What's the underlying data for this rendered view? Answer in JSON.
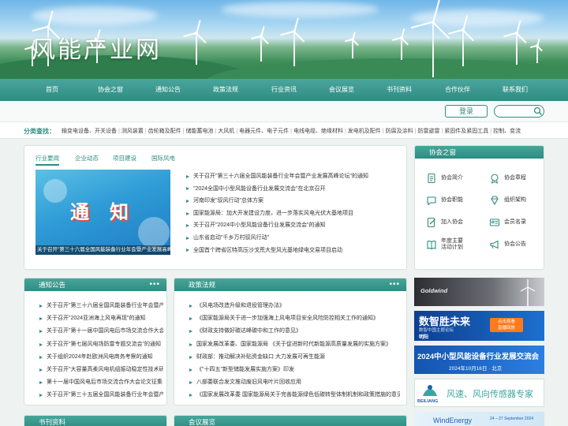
{
  "site": {
    "title": "风能产业网"
  },
  "nav": [
    "首页",
    "协会之窗",
    "通知公告",
    "政策法规",
    "行业资讯",
    "会议展览",
    "书刊资料",
    "合作伙伴",
    "联系我们"
  ],
  "subbar": {
    "login_label": "登录",
    "search_placeholder": ""
  },
  "categories": {
    "label": "分类查找：",
    "items": [
      "输变电设备、开关设备",
      "测风装置",
      "齿轮箱及配件",
      "储能蓄电池",
      "大风机",
      "电器元件、电子元件",
      "电线电缆、绝缘材料",
      "发电机及配件",
      "防腐及涂料",
      "防雷避雷",
      "紧固件及紧固工具",
      "控制、变流"
    ]
  },
  "news": {
    "tabs": [
      "行业要闻",
      "企业动态",
      "项目建设",
      "国际风电"
    ],
    "image_word": "通知",
    "image_caption": "关于召开\"第三十六届全国风能装备行业年会暨产业发展高峰论坛\"的通知",
    "items": [
      "关于召开\"第三十六届全国风能装备行业年会暨产业发展高峰论坛\"的通知",
      "\"2024全国中小型风能设备行业发展交流会\"在北京召开",
      "河南印发\"驭风行动\"总体方案",
      "国家能源局：加大开发建设力度，进一步落实风电光伏大基地项目",
      "关于召开\"2024中小型风能设备行业发展交流会\"的通知",
      "山东省启动\"千乡万村驭风行动\"",
      "全国首个跨省区特高压沙戈荒大型风光基地绿电交易项目启动"
    ]
  },
  "association": {
    "title": "协会之窗",
    "items": [
      {
        "label": "协会简介",
        "icon": "document-icon"
      },
      {
        "label": "协会章程",
        "icon": "seal-icon"
      },
      {
        "label": "协会职能",
        "icon": "chat-icon"
      },
      {
        "label": "组织架构",
        "icon": "diamond-icon"
      },
      {
        "label": "加入协会",
        "icon": "file-pen-icon"
      },
      {
        "label": "会员名录",
        "icon": "id-card-icon"
      },
      {
        "label": "年度主要\n活动计划",
        "icon": "book-icon"
      },
      {
        "label": "协会公告",
        "icon": "megaphone-icon"
      }
    ]
  },
  "notices": {
    "title": "通知公告",
    "more": "•••",
    "items": [
      "关于召开\"第三十六届全国风能装备行业年会暨产业发展高峰论坛\"的通知",
      "关于召开\"2024亚洲海上风电再现\"的通知",
      "关于召开\"第十一届中国风电后市场交流合作大会\"的通知",
      "关于召开\"第七届风电场防雷专题交流会\"的通知",
      "关于组织2024年赴欧洲风电商务考察的通知",
      "关于召开\"大容量高柔风电机组振动稳定性技术研讨会\"的通知",
      "第十一届中国风电后市场交流合作大会论文征集",
      "关于召开\"第三十五届全国风能装备行业年会暨产业发展高峰论坛\"的通知"
    ]
  },
  "policy": {
    "title": "政策法规",
    "more": "•••",
    "items": [
      "《风电场改造升级和退役管理办法》",
      "《国家能源局关于进一步加强海上风电项目安全风险防控相关工作的通知》",
      "《财政支持做好碳达峰碳中和工作的意见》",
      "国家发展改革委、国家能源局 《关于促进新时代新能源高质量发展的实施方案》",
      "财政部：推动解决补贴资金缺口 大力发展可再生能源",
      "《\"十四五\"新型储能发展实施方案》印发",
      "八部委联合发文推动废旧风电叶片回收应用",
      "《国家发展改革委 国家能源局关于完善能源绿色低碳转型体制机制和政策措施的意见》"
    ]
  },
  "books": {
    "title": "书刊资料"
  },
  "meetings": {
    "title": "会议展览"
  },
  "ads": {
    "goldwind": "Goldwind",
    "digital_title": "数智胜未来",
    "digital_sub": "数智中国主题论坛",
    "digital_brand": "明阳",
    "digital_btn": "点击观看\n直播回放",
    "conf_title": "2024中小型风能设备行业发展交流会",
    "conf_date": "2024年10月16日 · 北京",
    "beiliang_brand": "BEILIANG",
    "beiliang_slogan": "风速、风向传感器专家",
    "windenergy": "WindEnergy",
    "windenergy_date": "24 – 27 September 2024"
  },
  "colors": {
    "primary": "#2f8c82",
    "header_gradient_top": "#45a69a",
    "ad_blue": "#1d5fb8",
    "ad_teal": "#3aa6a0"
  }
}
